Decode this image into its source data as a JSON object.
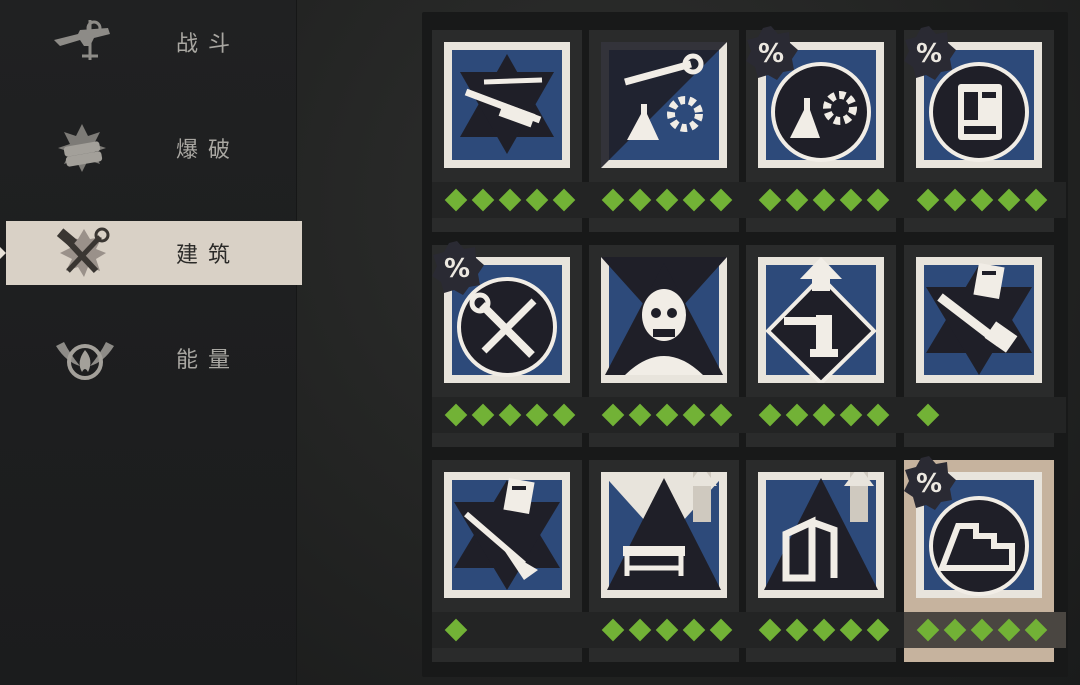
{
  "sidebar": {
    "items": [
      {
        "label": "战斗",
        "icon": "gun-icon",
        "active": false
      },
      {
        "label": "爆破",
        "icon": "explosive-icon",
        "active": false
      },
      {
        "label": "建筑",
        "icon": "hammer-wrench-icon",
        "active": true
      },
      {
        "label": "能量",
        "icon": "winged-flame-icon",
        "active": false
      }
    ]
  },
  "colors": {
    "rank_diamond": "#72b236",
    "card_blue": "#2d4a7a",
    "active_category": "#d9d1c6",
    "selected_card": "#c6b39e"
  },
  "perks": [
    {
      "icon": "saw-tools-icon",
      "ranks": 5,
      "discount_badge": false,
      "selected": false
    },
    {
      "icon": "wrench-flask-gear-icon",
      "ranks": 5,
      "discount_badge": false,
      "selected": false
    },
    {
      "icon": "flask-gear-icon",
      "ranks": 5,
      "discount_badge": true,
      "selected": false
    },
    {
      "icon": "schematic-book-icon",
      "ranks": 5,
      "discount_badge": true,
      "selected": false
    },
    {
      "icon": "wrench-screwdriver-icon",
      "ranks": 5,
      "discount_badge": true,
      "selected": false
    },
    {
      "icon": "zombie-skull-icon",
      "ranks": 5,
      "discount_badge": false,
      "selected": false
    },
    {
      "icon": "turret-upgrade-icon",
      "ranks": 5,
      "discount_badge": false,
      "selected": false
    },
    {
      "icon": "chainsaw-schematic-icon",
      "ranks": 1,
      "discount_badge": false,
      "selected": false
    },
    {
      "icon": "nailgun-schematic-icon",
      "ranks": 1,
      "discount_badge": false,
      "selected": false
    },
    {
      "icon": "workbench-upgrade-icon",
      "ranks": 5,
      "discount_badge": false,
      "selected": false
    },
    {
      "icon": "frame-upgrade-icon",
      "ranks": 5,
      "discount_badge": false,
      "selected": false
    },
    {
      "icon": "stairs-discount-icon",
      "ranks": 5,
      "discount_badge": true,
      "selected": true
    }
  ],
  "badge_text": "%"
}
